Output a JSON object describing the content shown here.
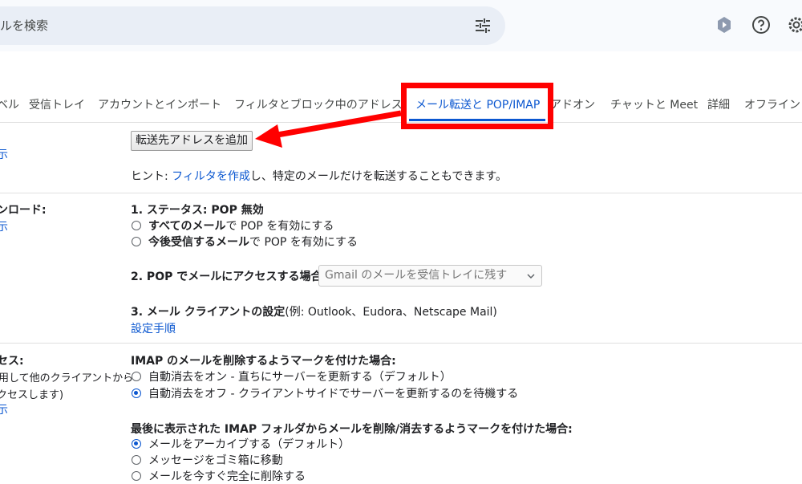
{
  "search": {
    "placeholder": "ルを検索"
  },
  "tabs": [
    {
      "label": "ベル"
    },
    {
      "label": "受信トレイ"
    },
    {
      "label": "アカウントとインポート"
    },
    {
      "label": "フィルタとブロック中のアドレス"
    },
    {
      "label": "メール転送と POP/IMAP"
    },
    {
      "label": "アドオン"
    },
    {
      "label": "チャットと Meet"
    },
    {
      "label": "詳細"
    },
    {
      "label": "オフライン"
    }
  ],
  "forwarding": {
    "left_label": "示",
    "add_button": "転送先アドレスを追加",
    "hint_prefix": "ヒント: ",
    "hint_link": "フィルタを作成",
    "hint_suffix": "し、特定のメールだけを転送することもできます。"
  },
  "pop": {
    "left_label": "ンロード:",
    "left_sub": "示",
    "status_title": "1. ステータス: POP 無効",
    "opt_all_bold": "すべてのメール",
    "opt_all_rest": "で POP を有効にする",
    "opt_future_bold": "今後受信するメール",
    "opt_future_rest": "で POP を有効にする",
    "access_title": "2. POP でメールにアクセスする場合",
    "access_select": "Gmail のメールを受信トレイに残す",
    "client_title": "3. メール クライアントの設定",
    "client_note": "(例: Outlook、Eudora、Netscape Mail)",
    "setup_link": "設定手順"
  },
  "imap": {
    "left_label": "セス:",
    "left_sub1": "用して他のクライアントから",
    "left_sub2": "クセスします)",
    "left_sub3": "示",
    "delete_title": "IMAP のメールを削除するようマークを付けた場合:",
    "expunge_on": "自動消去をオン - 直ちにサーバーを更新する（デフォルト）",
    "expunge_off": "自動消去をオフ - クライアントサイドでサーバーを更新するのを待機する",
    "last_folder_title": "最後に表示された IMAP フォルダからメールを削除/消去するようマークを付けた場合:",
    "archive": "メールをアーカイブする（デフォルト）",
    "trash": "メッセージをゴミ箱に移動",
    "delete_now": "メールを今すぐ完全に削除する"
  },
  "colors": {
    "accent": "#0b57d0",
    "highlight": "#ff0000"
  }
}
